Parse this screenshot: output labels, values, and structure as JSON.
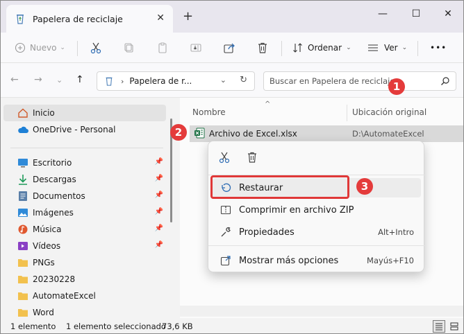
{
  "window": {
    "tab_title": "Papelera de reciclaje",
    "tab_close": "✕",
    "new_tab": "+",
    "minimize": "—",
    "maximize": "☐",
    "close": "✕"
  },
  "toolbar": {
    "new_label": "Nuevo",
    "sort_label": "Ordenar",
    "view_label": "Ver",
    "more_label": "•••"
  },
  "address": {
    "path": "Papelera de r...",
    "search_placeholder": "Buscar en Papelera de reciclaje"
  },
  "sidebar": {
    "items": [
      {
        "label": "Inicio",
        "icon": "home-icon",
        "pinned": false
      },
      {
        "label": "OneDrive - Personal",
        "icon": "cloud-icon",
        "pinned": false
      },
      {
        "label": "Escritorio",
        "icon": "desktop-icon",
        "pinned": true
      },
      {
        "label": "Descargas",
        "icon": "download-icon",
        "pinned": true
      },
      {
        "label": "Documentos",
        "icon": "documents-icon",
        "pinned": true
      },
      {
        "label": "Imágenes",
        "icon": "pictures-icon",
        "pinned": true
      },
      {
        "label": "Música",
        "icon": "music-icon",
        "pinned": true
      },
      {
        "label": "Vídeos",
        "icon": "videos-icon",
        "pinned": true
      },
      {
        "label": "PNGs",
        "icon": "folder-icon",
        "pinned": false
      },
      {
        "label": "20230228",
        "icon": "folder-icon",
        "pinned": false
      },
      {
        "label": "AutomateExcel",
        "icon": "folder-icon",
        "pinned": false
      },
      {
        "label": "Word",
        "icon": "folder-icon",
        "pinned": false
      }
    ]
  },
  "columns": {
    "name": "Nombre",
    "location": "Ubicación original"
  },
  "file": {
    "name": "Archivo de Excel.xlsx",
    "location": "D:\\AutomateExcel"
  },
  "context_menu": {
    "items": [
      {
        "label": "Restaurar",
        "shortcut": ""
      },
      {
        "label": "Comprimir en archivo ZIP",
        "shortcut": ""
      },
      {
        "label": "Propiedades",
        "shortcut": "Alt+Intro"
      },
      {
        "label": "Mostrar más opciones",
        "shortcut": "Mayús+F10"
      }
    ]
  },
  "badges": [
    "1",
    "2",
    "3"
  ],
  "status": {
    "count": "1 elemento",
    "selection": "1 elemento seleccionado",
    "size": "73,6 KB"
  },
  "colors": {
    "accent_red": "#e43b3b",
    "excel_green": "#1e7145",
    "folder_yellow": "#f2c14e"
  }
}
